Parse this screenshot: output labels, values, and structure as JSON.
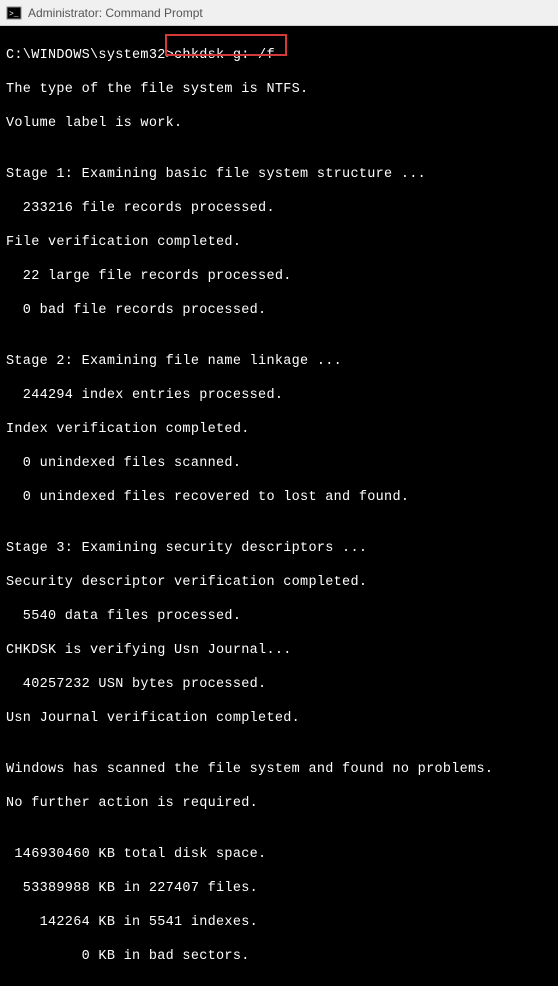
{
  "titlebar": {
    "title": "Administrator: Command Prompt"
  },
  "terminal": {
    "prompt": "C:\\WINDOWS\\system32>",
    "command": "chkdsk g: /f",
    "lines": [
      "The type of the file system is NTFS.",
      "Volume label is work.",
      "",
      "Stage 1: Examining basic file system structure ...",
      "  233216 file records processed.",
      "File verification completed.",
      "  22 large file records processed.",
      "  0 bad file records processed.",
      "",
      "Stage 2: Examining file name linkage ...",
      "  244294 index entries processed.",
      "Index verification completed.",
      "  0 unindexed files scanned.",
      "  0 unindexed files recovered to lost and found.",
      "",
      "Stage 3: Examining security descriptors ...",
      "Security descriptor verification completed.",
      "  5540 data files processed.",
      "CHKDSK is verifying Usn Journal...",
      "  40257232 USN bytes processed.",
      "Usn Journal verification completed.",
      "",
      "Windows has scanned the file system and found no problems.",
      "No further action is required.",
      "",
      " 146930460 KB total disk space.",
      "  53389988 KB in 227407 files.",
      "    142264 KB in 5541 indexes.",
      "         0 KB in bad sectors."
    ]
  }
}
